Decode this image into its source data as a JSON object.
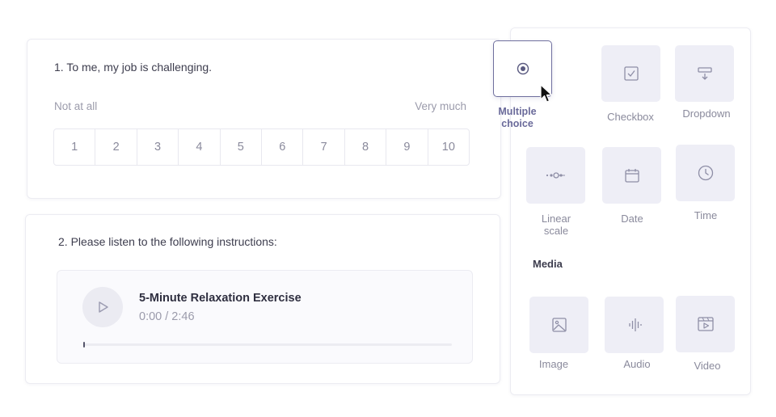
{
  "question1": {
    "title": "1. To me, my job is challenging.",
    "low_label": "Not at all",
    "high_label": "Very much",
    "options": [
      "1",
      "2",
      "3",
      "4",
      "5",
      "6",
      "7",
      "8",
      "9",
      "10"
    ]
  },
  "question2": {
    "title": "2. Please listen to the following instructions:",
    "audio": {
      "title": "5-Minute Relaxation Exercise",
      "time": "0:00 / 2:46",
      "progress_percent": 0
    }
  },
  "palette": {
    "dragged": {
      "label_line1": "Multiple",
      "label_line2": "choice",
      "icon": "radio-icon"
    },
    "items": [
      {
        "label_line1": "Checkbox",
        "label_line2": "",
        "icon": "checkbox-icon"
      },
      {
        "label_line1": "Dropdown",
        "label_line2": "",
        "icon": "dropdown-icon"
      },
      {
        "label_line1": "Linear",
        "label_line2": "scale",
        "icon": "linear-scale-icon"
      },
      {
        "label_line1": "Date",
        "label_line2": "",
        "icon": "calendar-icon"
      },
      {
        "label_line1": "Time",
        "label_line2": "",
        "icon": "clock-icon"
      }
    ],
    "media_heading": "Media",
    "media_items": [
      {
        "label_line1": "Image",
        "icon": "image-icon"
      },
      {
        "label_line1": "Audio",
        "icon": "audio-icon"
      },
      {
        "label_line1": "Video",
        "icon": "video-icon"
      }
    ]
  },
  "colors": {
    "accent": "#6a6a9a",
    "tile_bg": "#eeeef6",
    "muted_text": "#9b9bab"
  }
}
